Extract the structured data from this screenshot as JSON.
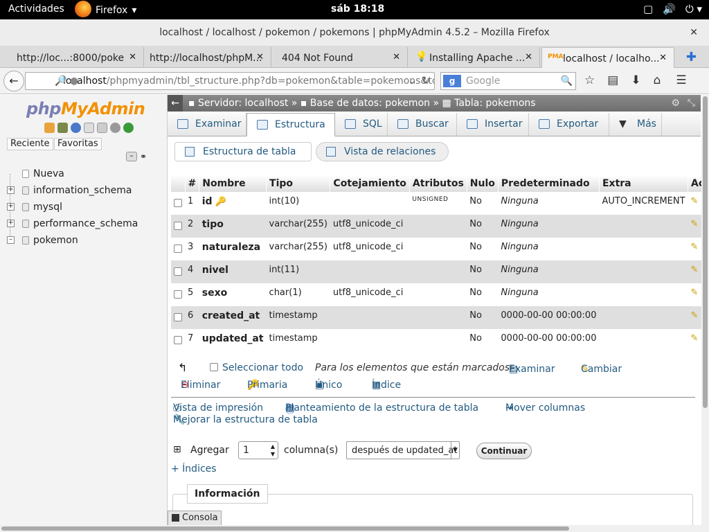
{
  "system": {
    "activities": "Actividades",
    "app": "Firefox",
    "clock": "sáb 18:18"
  },
  "window": {
    "title": "localhost / localhost / pokemon / pokemons | phpMyAdmin 4.5.2 – Mozilla Firefox"
  },
  "tabs": [
    {
      "label": "http://loc...:8000/poke"
    },
    {
      "label": "http://localhost/phpM..."
    },
    {
      "label": "404 Not Found"
    },
    {
      "label": "Installing Apache ..."
    },
    {
      "label": "localhost / localho..."
    }
  ],
  "url": {
    "host": "localhost",
    "path": "/phpmyadmin/tbl_structure.php?db=pokemon&table=pokemons&tc"
  },
  "search": {
    "placeholder": "Google",
    "engine": "g"
  },
  "sidebar": {
    "logo_php": "php",
    "logo_my": "MyAdmin",
    "recent": "Reciente",
    "favorites": "Favoritas",
    "tree": [
      {
        "label": "Nueva"
      },
      {
        "label": "information_schema"
      },
      {
        "label": "mysql"
      },
      {
        "label": "performance_schema"
      },
      {
        "label": "pokemon"
      }
    ]
  },
  "breadcrumb": {
    "server": "Servidor: localhost",
    "database": "Base de datos: pokemon",
    "table": "Tabla: pokemons"
  },
  "menu": {
    "browse": "Examinar",
    "structure": "Estructura",
    "sql": "SQL",
    "search": "Buscar",
    "insert": "Insertar",
    "export": "Exportar",
    "more": "Más"
  },
  "subtabs": {
    "table_structure": "Estructura de tabla",
    "relations": "Vista de relaciones"
  },
  "table": {
    "headers": [
      "#",
      "Nombre",
      "Tipo",
      "Cotejamiento",
      "Atributos",
      "Nulo",
      "Predeterminado",
      "Extra",
      "Acci"
    ],
    "rows": [
      {
        "num": "1",
        "name": "id",
        "type": "int(10)",
        "collation": "",
        "attributes": "UNSIGNED",
        "null": "No",
        "default": "Ninguna",
        "extra": "AUTO_INCREMENT",
        "action": "C"
      },
      {
        "num": "2",
        "name": "tipo",
        "type": "varchar(255)",
        "collation": "utf8_unicode_ci",
        "attributes": "",
        "null": "No",
        "default": "Ninguna",
        "extra": "",
        "action": "C"
      },
      {
        "num": "3",
        "name": "naturaleza",
        "type": "varchar(255)",
        "collation": "utf8_unicode_ci",
        "attributes": "",
        "null": "No",
        "default": "Ninguna",
        "extra": "",
        "action": "C"
      },
      {
        "num": "4",
        "name": "nivel",
        "type": "int(11)",
        "collation": "",
        "attributes": "",
        "null": "No",
        "default": "Ninguna",
        "extra": "",
        "action": "C"
      },
      {
        "num": "5",
        "name": "sexo",
        "type": "char(1)",
        "collation": "utf8_unicode_ci",
        "attributes": "",
        "null": "No",
        "default": "Ninguna",
        "extra": "",
        "action": "C"
      },
      {
        "num": "6",
        "name": "created_at",
        "type": "timestamp",
        "collation": "",
        "attributes": "",
        "null": "No",
        "default": "0000-00-00 00:00:00",
        "extra": "",
        "action": "C"
      },
      {
        "num": "7",
        "name": "updated_at",
        "type": "timestamp",
        "collation": "",
        "attributes": "",
        "null": "No",
        "default": "0000-00-00 00:00:00",
        "extra": "",
        "action": "C"
      }
    ]
  },
  "selection": {
    "select_all": "Seleccionar todo",
    "for_marked": "Para los elementos que están marcados:",
    "browse": "Examinar",
    "change": "Cambiar",
    "drop": "Eliminar",
    "primary": "Primaria",
    "unique": "Único",
    "index": "Índice"
  },
  "links": {
    "print_view": "Vista de impresión",
    "propose_structure": "Planteamiento de la estructura de tabla",
    "move_columns": "Mover columnas",
    "improve_structure": "Mejorar la estructura de tabla"
  },
  "add": {
    "label": "Agregar",
    "count": "1",
    "columns": "columna(s)",
    "position": "después de updated_at",
    "go": "Continuar"
  },
  "indices": "+ Índices",
  "info": "Información",
  "console": "Consola"
}
